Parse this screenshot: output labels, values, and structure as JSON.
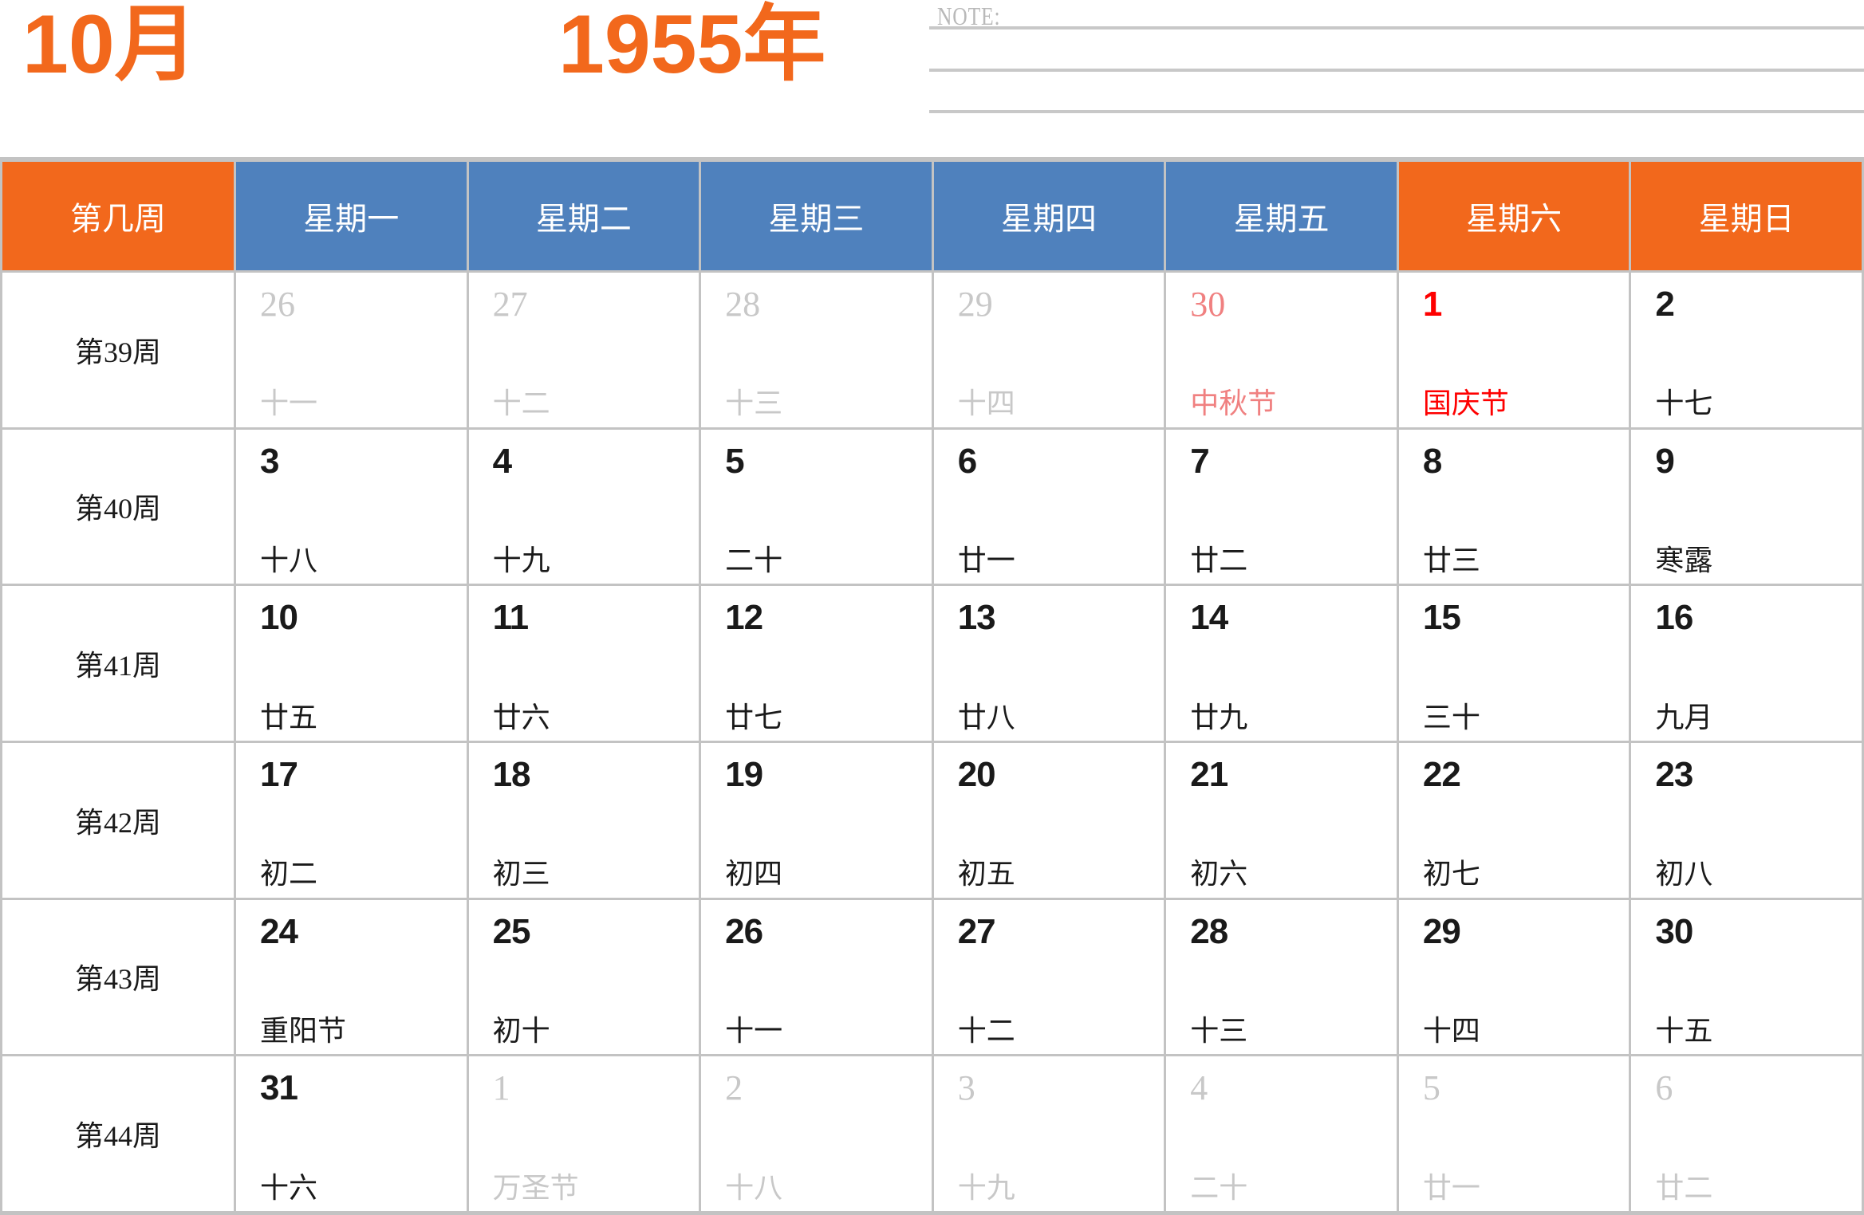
{
  "title": {
    "month": "10月",
    "year": "1955年"
  },
  "note": {
    "label": "NOTE:",
    "line_count": 3
  },
  "colors": {
    "orange": "#f2681c",
    "blue": "#4f81bd",
    "holiday_red": "#fe0000",
    "faded_red": "#f08080",
    "faded_gray": "#c8c8c8",
    "border_gray": "#c3c3c3",
    "text_black": "#1a1a1a",
    "note_gray": "#b9b9b9"
  },
  "calendar": {
    "corner_header": "第几周",
    "day_headers": [
      {
        "label": "星期一",
        "weekend": false
      },
      {
        "label": "星期二",
        "weekend": false
      },
      {
        "label": "星期三",
        "weekend": false
      },
      {
        "label": "星期四",
        "weekend": false
      },
      {
        "label": "星期五",
        "weekend": false
      },
      {
        "label": "星期六",
        "weekend": true
      },
      {
        "label": "星期日",
        "weekend": true
      }
    ],
    "weeks": [
      {
        "label": "第39周",
        "days": [
          {
            "num": "26",
            "lunar": "十一",
            "type": "outside"
          },
          {
            "num": "27",
            "lunar": "十二",
            "type": "outside"
          },
          {
            "num": "28",
            "lunar": "十三",
            "type": "outside"
          },
          {
            "num": "29",
            "lunar": "十四",
            "type": "outside"
          },
          {
            "num": "30",
            "lunar": "中秋节",
            "type": "outside-holiday"
          },
          {
            "num": "1",
            "lunar": "国庆节",
            "type": "holiday"
          },
          {
            "num": "2",
            "lunar": "十七",
            "type": "normal"
          }
        ]
      },
      {
        "label": "第40周",
        "days": [
          {
            "num": "3",
            "lunar": "十八",
            "type": "normal"
          },
          {
            "num": "4",
            "lunar": "十九",
            "type": "normal"
          },
          {
            "num": "5",
            "lunar": "二十",
            "type": "normal"
          },
          {
            "num": "6",
            "lunar": "廿一",
            "type": "normal"
          },
          {
            "num": "7",
            "lunar": "廿二",
            "type": "normal"
          },
          {
            "num": "8",
            "lunar": "廿三",
            "type": "normal"
          },
          {
            "num": "9",
            "lunar": "寒露",
            "type": "normal"
          }
        ]
      },
      {
        "label": "第41周",
        "days": [
          {
            "num": "10",
            "lunar": "廿五",
            "type": "normal"
          },
          {
            "num": "11",
            "lunar": "廿六",
            "type": "normal"
          },
          {
            "num": "12",
            "lunar": "廿七",
            "type": "normal"
          },
          {
            "num": "13",
            "lunar": "廿八",
            "type": "normal"
          },
          {
            "num": "14",
            "lunar": "廿九",
            "type": "normal"
          },
          {
            "num": "15",
            "lunar": "三十",
            "type": "normal"
          },
          {
            "num": "16",
            "lunar": "九月",
            "type": "normal"
          }
        ]
      },
      {
        "label": "第42周",
        "days": [
          {
            "num": "17",
            "lunar": "初二",
            "type": "normal"
          },
          {
            "num": "18",
            "lunar": "初三",
            "type": "normal"
          },
          {
            "num": "19",
            "lunar": "初四",
            "type": "normal"
          },
          {
            "num": "20",
            "lunar": "初五",
            "type": "normal"
          },
          {
            "num": "21",
            "lunar": "初六",
            "type": "normal"
          },
          {
            "num": "22",
            "lunar": "初七",
            "type": "normal"
          },
          {
            "num": "23",
            "lunar": "初八",
            "type": "normal"
          }
        ]
      },
      {
        "label": "第43周",
        "days": [
          {
            "num": "24",
            "lunar": "重阳节",
            "type": "normal"
          },
          {
            "num": "25",
            "lunar": "初十",
            "type": "normal"
          },
          {
            "num": "26",
            "lunar": "十一",
            "type": "normal"
          },
          {
            "num": "27",
            "lunar": "十二",
            "type": "normal"
          },
          {
            "num": "28",
            "lunar": "十三",
            "type": "normal"
          },
          {
            "num": "29",
            "lunar": "十四",
            "type": "normal"
          },
          {
            "num": "30",
            "lunar": "十五",
            "type": "normal"
          }
        ]
      },
      {
        "label": "第44周",
        "days": [
          {
            "num": "31",
            "lunar": "十六",
            "type": "normal"
          },
          {
            "num": "1",
            "lunar": "万圣节",
            "type": "outside"
          },
          {
            "num": "2",
            "lunar": "十八",
            "type": "outside"
          },
          {
            "num": "3",
            "lunar": "十九",
            "type": "outside"
          },
          {
            "num": "4",
            "lunar": "二十",
            "type": "outside"
          },
          {
            "num": "5",
            "lunar": "廿一",
            "type": "outside"
          },
          {
            "num": "6",
            "lunar": "廿二",
            "type": "outside"
          }
        ]
      }
    ]
  }
}
